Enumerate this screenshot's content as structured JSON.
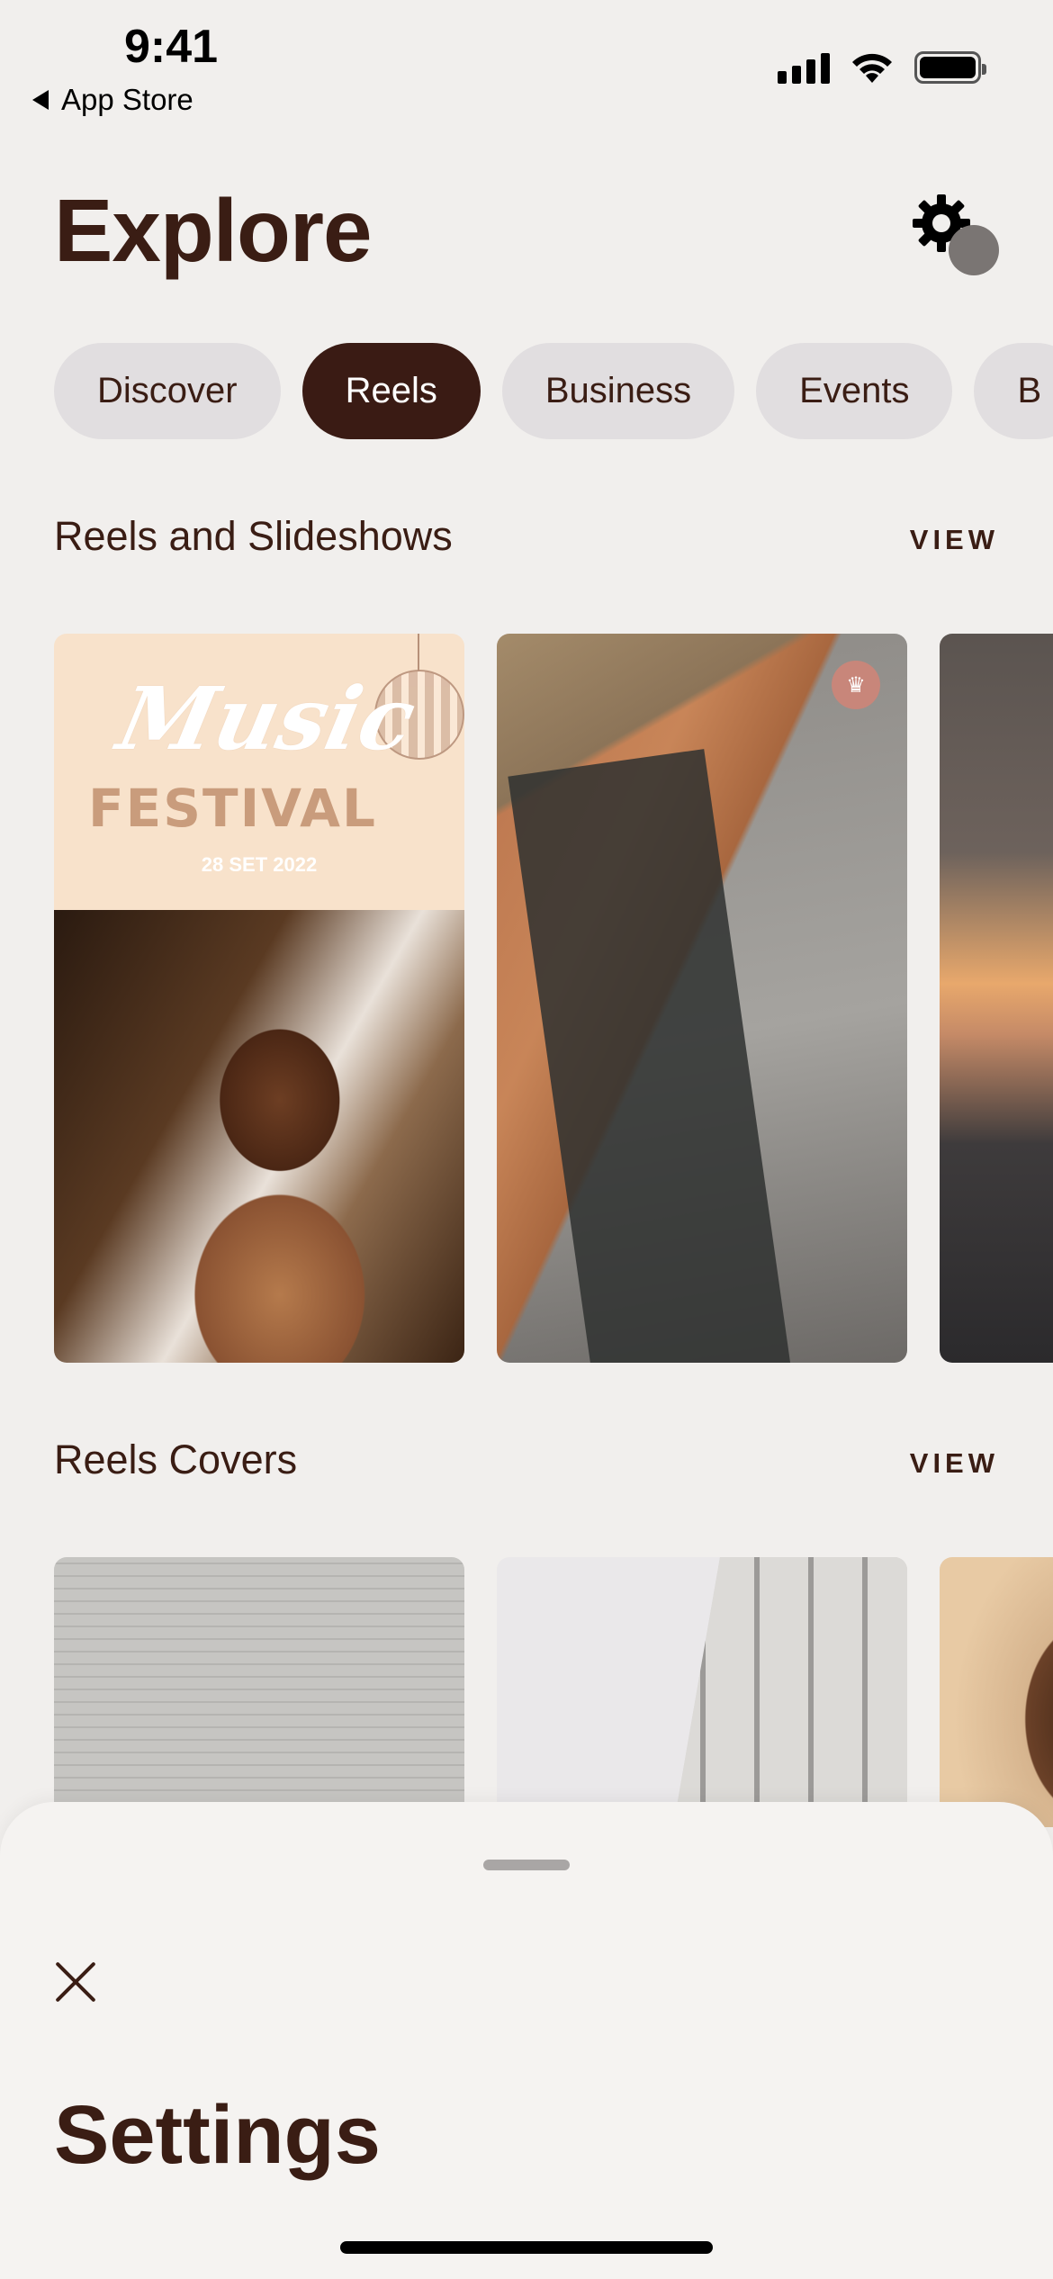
{
  "status_bar": {
    "time": "9:41",
    "back_app": "App Store"
  },
  "header": {
    "title": "Explore"
  },
  "chips": [
    {
      "label": "Discover",
      "active": false
    },
    {
      "label": "Reels",
      "active": true
    },
    {
      "label": "Business",
      "active": false
    },
    {
      "label": "Events",
      "active": false
    },
    {
      "label": "B",
      "active": false
    }
  ],
  "sections": [
    {
      "title": "Reels and Slideshows",
      "view_label": "VIEW"
    },
    {
      "title": "Reels Covers",
      "view_label": "VIEW"
    }
  ],
  "cards": {
    "music_poster": {
      "script": "Music",
      "headline": "FESTIVAL",
      "date": "28 SET 2022"
    }
  },
  "sheet": {
    "title": "Settings"
  },
  "colors": {
    "primary": "#3a1b14",
    "chip_bg": "#e1dee0",
    "page_bg": "#f1efed",
    "sheet_bg": "#f5f3f1"
  }
}
